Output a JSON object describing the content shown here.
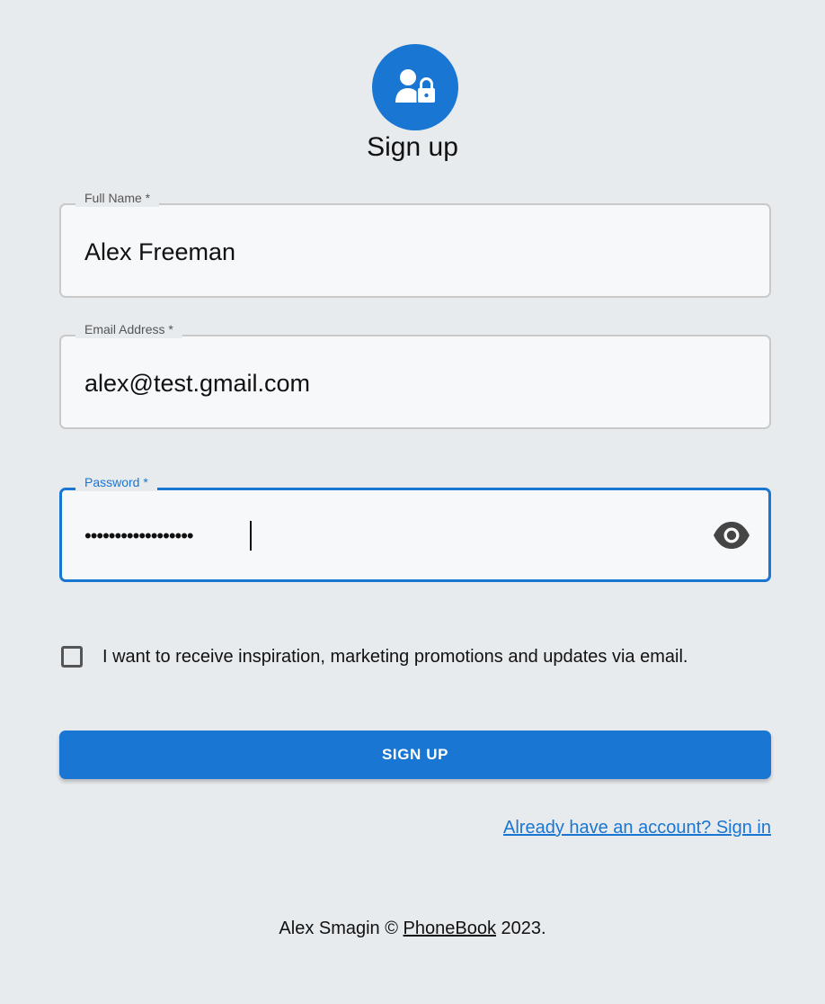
{
  "header": {
    "title": "Sign up",
    "avatar_icon": "person-lock-icon",
    "accent": "#1976d2"
  },
  "form": {
    "full_name": {
      "label": "Full Name *",
      "value": "Alex Freeman"
    },
    "email": {
      "label": "Email Address *",
      "value": "alex@test.gmail.com"
    },
    "password": {
      "label": "Password *",
      "masked_value": "••••••••••••••••••",
      "toggle_icon": "eye-icon"
    },
    "marketing_opt_in": {
      "label": "I want to receive inspiration, marketing promotions and updates via email.",
      "checked": false
    },
    "submit_label": "SIGN UP",
    "signin_link": "Already have an account? Sign in"
  },
  "footer": {
    "author": "Alex Smagin ©",
    "brand": "PhoneBook",
    "year": "2023."
  }
}
